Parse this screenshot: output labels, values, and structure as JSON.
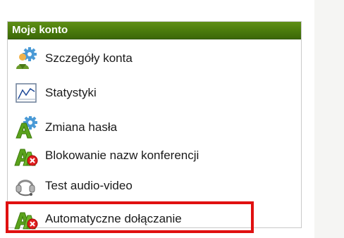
{
  "panel": {
    "title": "Moje konto",
    "header_color": "#4f7f0f"
  },
  "menu": {
    "items": [
      {
        "label": "Szczegóły konta",
        "icon": "user-gear-icon"
      },
      {
        "label": "Statystyki",
        "icon": "chart-line-icon"
      },
      {
        "label": "Zmiana hasła",
        "icon": "letter-a-gear-icon"
      },
      {
        "label": "Blokowanie nazw konferencji",
        "icon": "letter-a-block-icon"
      },
      {
        "label": "Test audio-video",
        "icon": "headset-icon"
      },
      {
        "label": "Automatyczne dołączanie",
        "icon": "letter-a-block-icon"
      }
    ]
  },
  "highlight": {
    "color": "#e01010",
    "target_item": "Automatyczne dołączanie"
  }
}
